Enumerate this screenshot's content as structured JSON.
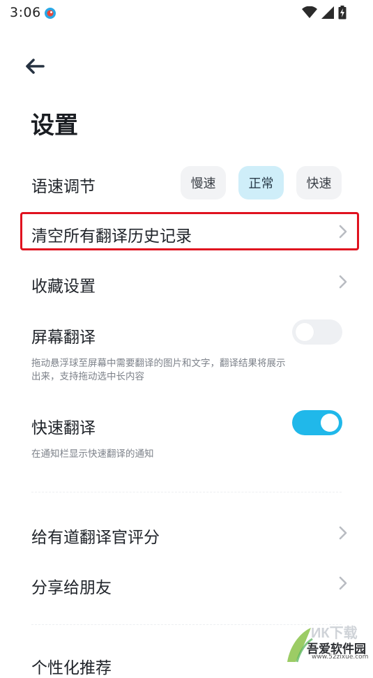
{
  "status_bar": {
    "time": "3:06"
  },
  "header": {
    "title": "设置",
    "back_icon": "arrow-left-icon"
  },
  "speech_rate": {
    "label": "语速调节",
    "options": [
      "慢速",
      "正常",
      "快速"
    ],
    "selected": "正常"
  },
  "clear_history": {
    "label": "清空所有翻译历史记录"
  },
  "favorites": {
    "label": "收藏设置"
  },
  "screen_translate": {
    "label": "屏幕翻译",
    "enabled": false,
    "description": "拖动悬浮球至屏幕中需要翻译的图片和文字，翻译结果将展示出来，支持拖动选中长内容"
  },
  "quick_translate": {
    "label": "快速翻译",
    "enabled": true,
    "description": "在通知栏显示快速翻译的通知"
  },
  "rate_app": {
    "label": "给有道翻译官评分"
  },
  "share": {
    "label": "分享给朋友"
  },
  "personalized": {
    "label": "个性化推荐"
  },
  "watermark": {
    "name": "吾爱软件园",
    "url": "www.52zixue.com"
  },
  "colors": {
    "accent": "#20b8ea",
    "selected_chip": "#cfeef9",
    "highlight_border": "#e0121f"
  }
}
